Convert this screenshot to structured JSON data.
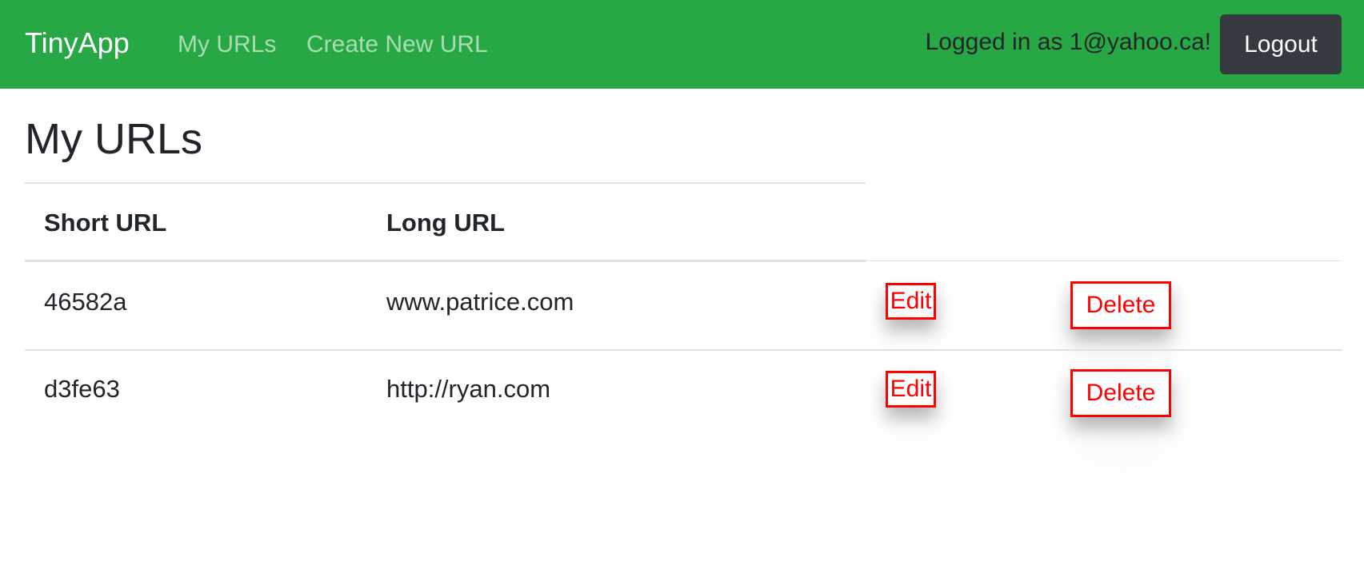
{
  "navbar": {
    "brand": "TinyApp",
    "links": {
      "my_urls": "My URLs",
      "create_new_url": "Create New URL"
    },
    "logged_in_text": "Logged in as 1@yahoo.ca!",
    "logout_label": "Logout",
    "colors": {
      "background": "#28a745",
      "logout_button": "#343a40"
    }
  },
  "main": {
    "title": "My URLs",
    "table": {
      "headers": {
        "short_url": "Short URL",
        "long_url": "Long URL"
      },
      "rows": [
        {
          "short_url": "46582a",
          "long_url": "www.patrice.com",
          "edit_label": "Edit",
          "delete_label": "Delete"
        },
        {
          "short_url": "d3fe63",
          "long_url": "http://ryan.com",
          "edit_label": "Edit",
          "delete_label": "Delete"
        }
      ]
    },
    "colors": {
      "action_button": "#ff0000"
    }
  }
}
